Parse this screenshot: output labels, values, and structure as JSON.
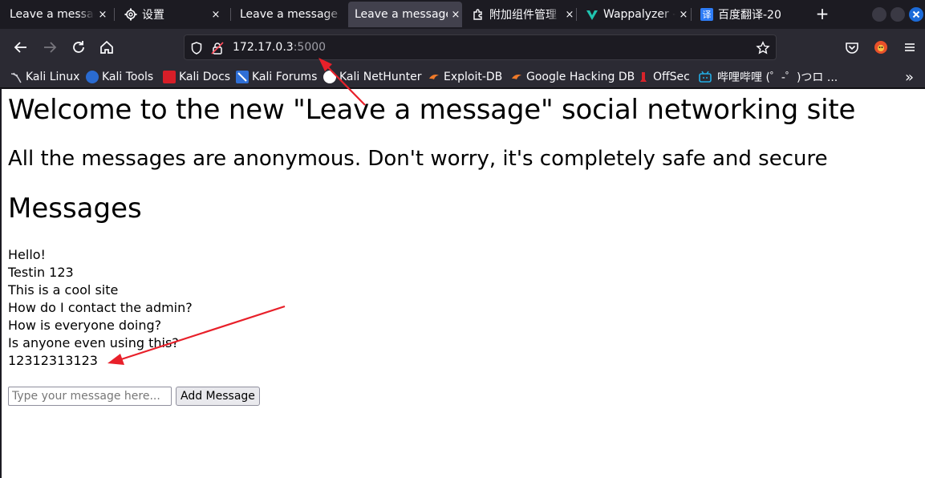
{
  "browser": {
    "tabs": [
      {
        "title": "Leave a message",
        "favicon": "none",
        "active": false
      },
      {
        "title": "设置",
        "favicon": "gear-icon",
        "active": false
      },
      {
        "title": "Leave a message",
        "favicon": "none",
        "active": false
      },
      {
        "title": "Leave a message",
        "favicon": "none",
        "active": true
      },
      {
        "title": "附加组件管理",
        "favicon": "puzzle-icon",
        "active": false
      },
      {
        "title": "Wappalyzer -",
        "favicon": "wappalyzer-icon",
        "active": false
      },
      {
        "title": "百度翻译-20",
        "favicon": "baidu-translate-icon",
        "active": false
      }
    ],
    "tab_close_glyph": "×",
    "new_tab_glyph": "+",
    "address": {
      "host": "172.17.0.3",
      "port": ":5000"
    },
    "bookmarks": [
      {
        "label": "Kali Linux",
        "icon": "kali-icon"
      },
      {
        "label": "Kali Tools",
        "icon": "kali-tools-icon"
      },
      {
        "label": "Kali Docs",
        "icon": "kali-docs-icon"
      },
      {
        "label": "Kali Forums",
        "icon": "kali-forums-icon"
      },
      {
        "label": "Kali NetHunter",
        "icon": "nethunter-icon"
      },
      {
        "label": "Exploit-DB",
        "icon": "exploit-db-icon"
      },
      {
        "label": "Google Hacking DB",
        "icon": "ghdb-icon"
      },
      {
        "label": "OffSec",
        "icon": "offsec-icon"
      },
      {
        "label": "哔哩哔哩 (゜-゜)つロ ...",
        "icon": "bilibili-icon"
      }
    ],
    "overflow_glyph": "»",
    "colors": {
      "tab_strip": "#1c1b22",
      "toolbar": "#2b2a33",
      "active_tab": "#42414d",
      "url_field": "#1c1b22",
      "annotation_arrow": "#e8202a"
    }
  },
  "page": {
    "title": "Welcome to the new \"Leave a message\" social networking site",
    "subtitle": "All the messages are anonymous. Don't worry, it's completely safe and secure",
    "messages_heading": "Messages",
    "messages": [
      "Hello!",
      "Testin 123",
      "This is a cool site",
      "How do I contact the admin?",
      "How is everyone doing?",
      "Is anyone even using this?",
      "12312313123"
    ],
    "form": {
      "placeholder": "Type your message here...",
      "value": "",
      "submit_label": "Add Message"
    }
  }
}
